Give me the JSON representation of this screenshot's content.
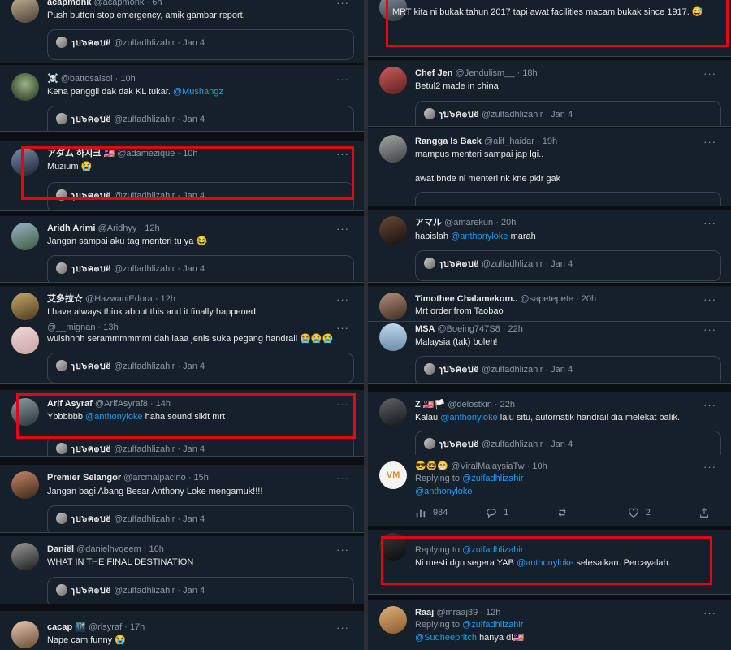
{
  "left": [
    {
      "name": "acapmonk",
      "handle": "@acapmonk",
      "time": "6h",
      "text": "Push button stop emergency, amik gambar report.",
      "quote": {
        "name": "ɿบ๖ค๏บë",
        "handle": "@zulfadhlizahir",
        "date": "Jan 4"
      }
    },
    {
      "name": "☠️",
      "handle": "@battosaisoi",
      "time": "10h",
      "text_plain": "Kena panggil dak dak KL tukar.",
      "mention": "@Mushangz",
      "quote": {
        "name": "ɿบ๖ค๏บë",
        "handle": "@zulfadhlizahir",
        "date": "Jan 4"
      }
    },
    {
      "name": "アダム 하지크 🇲🇾",
      "handle": "@adamezique",
      "time": "10h",
      "text": "Muzium 😭",
      "quote": {
        "name": "ɿบ๖ค๏บë",
        "handle": "@zulfadhlizahir",
        "date": "Jan 4"
      }
    },
    {
      "name": "Aridh Arimi",
      "handle": "@Aridhyy",
      "time": "12h",
      "text": "Jangan sampai aku tag menteri tu ya 😂",
      "quote": {
        "name": "ɿบ๖ค๏บë",
        "handle": "@zulfadhlizahir",
        "date": "Jan 4"
      }
    },
    {
      "name": "艾多拉☆",
      "handle": "@HazwaniEdora",
      "time": "12h",
      "text": "I have always think about this and it finally happened"
    },
    {
      "name": "",
      "handle": "@__mignan",
      "time": "13h",
      "text": "wuishhhh serammmmmm! dah laaa jenis suka pegang handrail 😭😭😭",
      "quote": {
        "name": "ɿบ๖ค๏บë",
        "handle": "@zulfadhlizahir",
        "date": "Jan 4"
      }
    },
    {
      "name": "Arif Asyraf",
      "handle": "@ArifAsyraf8",
      "time": "14h",
      "text_pre": "Ybbbbbb",
      "mention": "@anthonyloke",
      "text_post": "haha sound sikit mrt",
      "quote": {
        "name": "ɿบ๖ค๏บë",
        "handle": "@zulfadhlizahir",
        "date": "Jan 4"
      }
    },
    {
      "name": "Premier Selangor",
      "handle": "@arcmalpacino",
      "time": "15h",
      "text": "Jangan bagi Abang Besar Anthony Loke mengamuk!!!!",
      "quote": {
        "name": "ɿบ๖ค๏บë",
        "handle": "@zulfadhlizahir",
        "date": "Jan 4"
      }
    },
    {
      "name": "Daniël",
      "handle": "@danielhvqeem",
      "time": "16h",
      "text": "WHAT IN THE FINAL DESTINATION",
      "quote": {
        "name": "ɿบ๖ค๏บë",
        "handle": "@zulfadhlizahir",
        "date": "Jan 4"
      }
    },
    {
      "name": "cacap 🌃",
      "handle": "@rlsyraf",
      "time": "17h",
      "text": "Nape cam funny 😭"
    }
  ],
  "right": [
    {
      "text": "MRT kita ni bukak tahun 2017 tapi awat facilities macam bukak since 1917. 😅"
    },
    {
      "name": "Chef Jen",
      "handle": "@Jendulism__",
      "time": "18h",
      "text": "Betul2 made in china",
      "quote": {
        "name": "ɿบ๖ค๏บë",
        "handle": "@zulfadhlizahir",
        "date": "Jan 4"
      }
    },
    {
      "name": "Rangga Is Back",
      "handle": "@alif_haidar",
      "time": "19h",
      "text": "mampus menteri sampai jap lgi..\n\nawat bnde ni menteri nk kne pkir gak"
    },
    {
      "name": "アマル",
      "handle": "@amarekun",
      "time": "20h",
      "text_pre": "habislah",
      "mention": "@anthonyloke",
      "text_post": "marah",
      "quote": {
        "name": "ɿบ๖ค๏บë",
        "handle": "@zulfadhlizahir",
        "date": "Jan 4"
      }
    },
    {
      "name": "Timothee Chalamekom..",
      "handle": "@sapetepete",
      "time": "20h",
      "text": "Mrt order from Taobao"
    },
    {
      "name": "MSA",
      "handle": "@Boeing747S8",
      "time": "22h",
      "text": "Malaysia (tak) boleh!",
      "quote": {
        "name": "ɿบ๖ค๏บë",
        "handle": "@zulfadhlizahir",
        "date": "Jan 4"
      }
    },
    {
      "name": "Z 🇲🇾🏳️",
      "handle": "@delostkin",
      "time": "22h",
      "text_pre": "Kalau",
      "mention": "@anthonyloke",
      "text_post": "lalu situ, automatik handrail dia melekat balik.",
      "quote": {
        "name": "ɿบ๖ค๏บë",
        "handle": "@zulfadhlizahir",
        "date": "Jan 4"
      }
    },
    {
      "name": "😎🤓😁",
      "handle": "@ViralMalaysiaTw",
      "time": "10h",
      "avatar": "VM",
      "replying": "Replying to",
      "reply_to": "@zulfadhlizahir",
      "mention_line": "@anthonyloke",
      "stats": {
        "replies": "984",
        "retweets": "1",
        "likes": "2"
      }
    },
    {
      "name": "",
      "handle": "",
      "time": "",
      "replying": "Replying to",
      "reply_to": "@zulfadhlizahir",
      "text_pre": "Ni mesti dgn segera YAB",
      "mention": "@anthonyloke",
      "text_post": "selesaikan. Percayalah.",
      "stats": {
        "replies": "",
        "retweets": "",
        "likes": ""
      }
    },
    {
      "name": "Raaj",
      "handle": "@mraaj89",
      "time": "12h",
      "replying": "Replying to",
      "reply_to": "@zulfadhlizahir",
      "mention": "@Sudheepritch",
      "text_post": "hanya di🇲🇾"
    }
  ],
  "more_label": "···"
}
